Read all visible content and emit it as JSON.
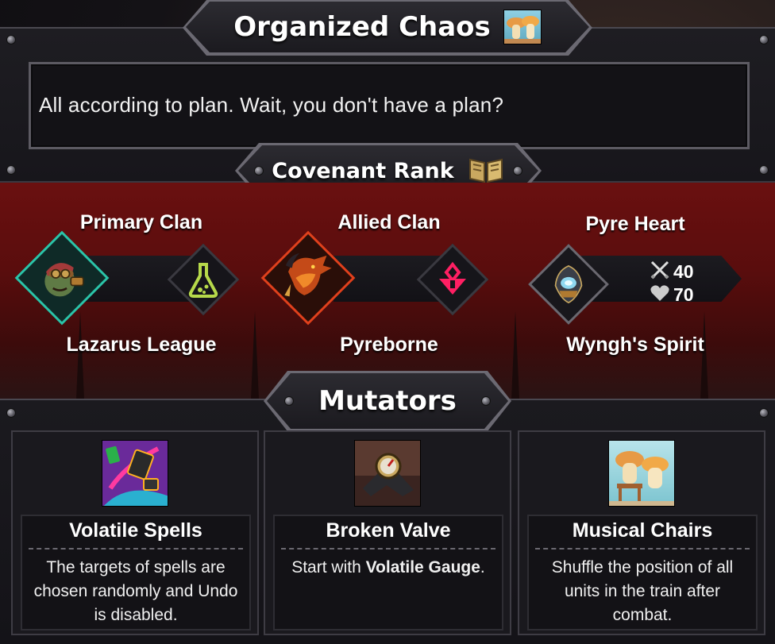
{
  "header": {
    "title": "Organized Chaos",
    "icon": "mushroom-pair-icon"
  },
  "description": "All according to plan. Wait, you don't have a plan?",
  "covenant": {
    "label": "Covenant Rank",
    "icon": "open-book-icon"
  },
  "clans": {
    "primary": {
      "heading": "Primary Clan",
      "name": "Lazarus League",
      "portrait": "goggled-alchemist-portrait",
      "emblem": "flask-icon",
      "accent": "#2bc3a8",
      "emblem_color": "#b6d94a"
    },
    "allied": {
      "heading": "Allied Clan",
      "name": "Pyreborne",
      "portrait": "dragon-portrait",
      "emblem": "pyreborne-sigil-icon",
      "accent": "#e0401c",
      "emblem_color": "#ff1f63"
    }
  },
  "pyre_heart": {
    "heading": "Pyre Heart",
    "name": "Wyngh's Spirit",
    "icon": "pyre-heart-icon",
    "attack": "40",
    "health": "70",
    "attack_icon": "crossed-swords-icon",
    "health_icon": "heart-icon"
  },
  "mutators": {
    "title": "Mutators",
    "items": [
      {
        "name": "Volatile Spells",
        "desc_pre": "The targets of spells are chosen randomly and Undo is disabled.",
        "desc_bold": "",
        "desc_post": "",
        "icon": "volatile-spells-icon"
      },
      {
        "name": "Broken Valve",
        "desc_pre": "Start with ",
        "desc_bold": "Volatile Gauge",
        "desc_post": ".",
        "icon": "broken-valve-icon"
      },
      {
        "name": "Musical Chairs",
        "desc_pre": "Shuffle the position of all units in the train after combat.",
        "desc_bold": "",
        "desc_post": "",
        "icon": "musical-chairs-icon"
      }
    ]
  }
}
